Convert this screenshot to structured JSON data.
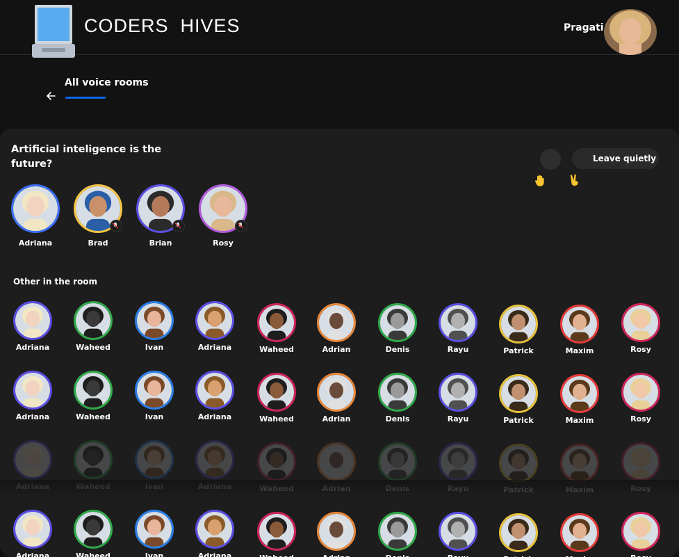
{
  "header": {
    "brand": "CODERS  HIVES",
    "user_name": "Pragati"
  },
  "nav": {
    "title": "All voice rooms"
  },
  "room": {
    "title": "Artificial inteligence is the future?",
    "leave_label": "Leave quietly",
    "speakers": [
      {
        "name": "Adriana",
        "color": "#3b6ef5",
        "skin": "#f1d3c0",
        "hair": "#f2e7c4"
      },
      {
        "name": "Brad",
        "color": "#f5c542",
        "skin": "#c9916a",
        "hair": "#2a5fa8"
      },
      {
        "name": "Brian",
        "color": "#5b4ee6",
        "skin": "#b57a5a",
        "hair": "#2b2b2b"
      },
      {
        "name": "Rosy",
        "color": "#b25be0",
        "skin": "#e8b89a",
        "hair": "#d9b88a"
      }
    ],
    "others_label": "Other in the room",
    "others": [
      {
        "name": "Adriana",
        "color": "#5b4ee6",
        "skin": "#f1d3c0",
        "hair": "#f2e7c4"
      },
      {
        "name": "Waheed",
        "color": "#2faa4a",
        "skin": "#3a3a3a",
        "hair": "#1e1e1e"
      },
      {
        "name": "Ivan",
        "color": "#2a7ee8",
        "skin": "#e8b59a",
        "hair": "#7a4a2a"
      },
      {
        "name": "Adriana",
        "color": "#5b4ee6",
        "skin": "#d9a070",
        "hair": "#8a5a2a"
      },
      {
        "name": "Waheed",
        "color": "#d0245a",
        "skin": "#8a5a3a",
        "hair": "#1e1e1e"
      },
      {
        "name": "Adrian",
        "color": "#e8883a",
        "skin": "#6a4a3a",
        "hair": "#e0e0e0"
      },
      {
        "name": "Denis",
        "color": "#2faa4a",
        "skin": "#9a9a9a",
        "hair": "#3a3a3a"
      },
      {
        "name": "Rayu",
        "color": "#5b4ee6",
        "skin": "#b0b0b0",
        "hair": "#505050"
      },
      {
        "name": "Patrick",
        "color": "#e8c23a",
        "skin": "#c09070",
        "hair": "#3a2a1a"
      },
      {
        "name": "Maxim",
        "color": "#e83a3a",
        "skin": "#e0b090",
        "hair": "#5a3a1a"
      },
      {
        "name": "Rosy",
        "color": "#d0245a",
        "skin": "#f0c8a8",
        "hair": "#e8d098"
      }
    ]
  },
  "icons": {
    "laptop": "laptop-icon",
    "back": "arrow-left-icon",
    "hand": "raised-hand-icon",
    "peace": "victory-hand-icon",
    "mic": "microphone-muted-icon"
  }
}
